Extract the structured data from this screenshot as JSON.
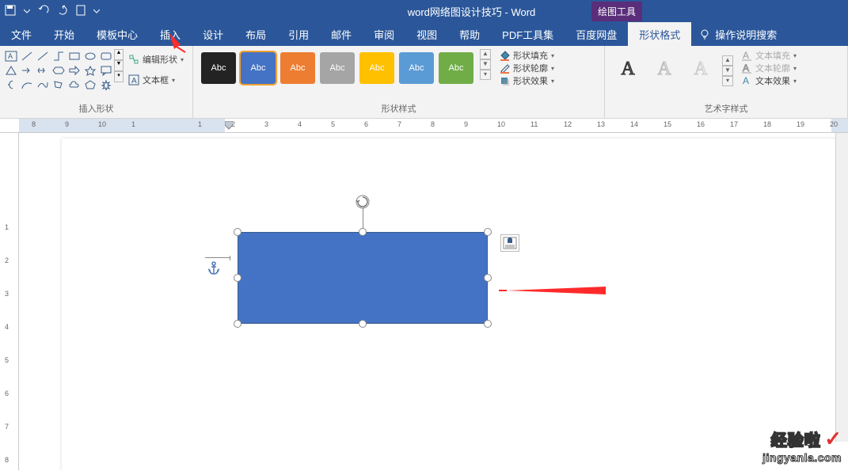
{
  "app": {
    "title": "word网络图设计技巧 - Word",
    "toolsTab": "绘图工具"
  },
  "menu": {
    "items": [
      "文件",
      "开始",
      "模板中心",
      "插入",
      "设计",
      "布局",
      "引用",
      "邮件",
      "审阅",
      "视图",
      "帮助",
      "PDF工具集",
      "百度网盘",
      "形状格式"
    ],
    "activeIndex": 13,
    "tellMe": "操作说明搜索"
  },
  "ribbon": {
    "insertShapes": {
      "label": "插入形状",
      "editShape": "编辑形状",
      "textBox": "文本框"
    },
    "shapeStyles": {
      "label": "形状样式",
      "thumbText": "Abc",
      "thumbs": [
        {
          "bg": "#232323"
        },
        {
          "bg": "#4472c4",
          "selected": true
        },
        {
          "bg": "#ed7d31"
        },
        {
          "bg": "#a5a5a5"
        },
        {
          "bg": "#ffc000"
        },
        {
          "bg": "#5b9bd5"
        },
        {
          "bg": "#70ad47"
        }
      ],
      "fill": "形状填充",
      "outline": "形状轮廓",
      "effects": "形状效果"
    },
    "wordArt": {
      "label": "艺术字样式",
      "glyph": "A",
      "items": [
        {
          "color": "#555",
          "stroke": "#333"
        },
        {
          "color": "#ddd",
          "stroke": "#bbb"
        },
        {
          "color": "#eee",
          "stroke": "#ccc"
        }
      ],
      "textFill": "文本填充",
      "textOutline": "文本轮廓",
      "textEffects": "文本效果"
    }
  },
  "ruler": {
    "hNums": [
      8,
      9,
      10,
      1,
      "",
      1,
      2,
      3,
      4,
      5,
      6,
      7,
      8,
      9,
      10,
      11,
      12,
      13,
      14,
      15,
      16,
      17,
      18,
      19,
      20
    ],
    "vNums": [
      "",
      "",
      1,
      2,
      3,
      4,
      5,
      6,
      7,
      8
    ]
  },
  "watermark": {
    "line1": "经验啦",
    "check": "✓",
    "line2": "jingyanla.com"
  }
}
